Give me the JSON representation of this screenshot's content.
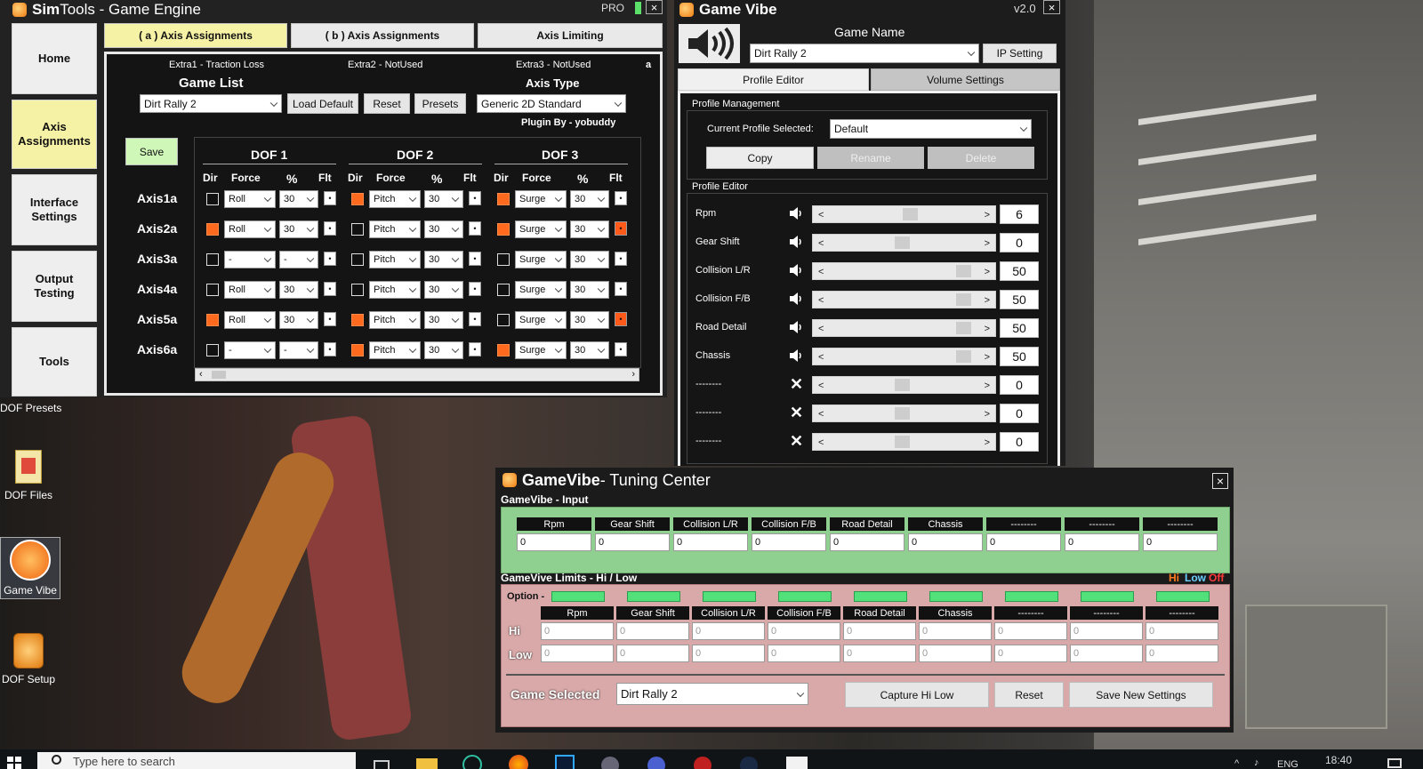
{
  "simtools": {
    "title_sim": "Sim",
    "title_rest": "Tools - Game Engine",
    "pro": "PRO",
    "close": "×",
    "sidebar": [
      "Home",
      "Axis\nAssignments",
      "Interface\nSettings",
      "Output\nTesting",
      "Tools"
    ],
    "tabs": [
      "( a ) Axis Assignments",
      "( b ) Axis Assignments",
      "Axis Limiting"
    ],
    "extras": [
      "Extra1 - Traction Loss",
      "Extra2 - NotUsed",
      "Extra3 - NotUsed"
    ],
    "extra_a": "a",
    "game_list_label": "Game List",
    "game_selected": "Dirt Rally 2",
    "load_default": "Load Default",
    "reset": "Reset",
    "presets": "Presets",
    "axis_type_label": "Axis Type",
    "axis_type": "Generic 2D Standard",
    "plugin_by": "Plugin By - yobuddy",
    "save": "Save",
    "dofs": [
      "DOF 1",
      "DOF 2",
      "DOF 3"
    ],
    "col_headers": {
      "dir": "Dir",
      "force": "Force",
      "pct": "%",
      "flt": "Flt"
    },
    "rows": [
      {
        "axis": "Axis1a",
        "d": [
          {
            "dir": false,
            "force": "Roll",
            "pct": "30",
            "flt": false
          },
          {
            "dir": true,
            "force": "Pitch",
            "pct": "30",
            "flt": false
          },
          {
            "dir": true,
            "force": "Surge",
            "pct": "30",
            "flt": false
          }
        ]
      },
      {
        "axis": "Axis2a",
        "d": [
          {
            "dir": true,
            "force": "Roll",
            "pct": "30",
            "flt": false
          },
          {
            "dir": false,
            "force": "Pitch",
            "pct": "30",
            "flt": false
          },
          {
            "dir": true,
            "force": "Surge",
            "pct": "30",
            "flt": true
          }
        ]
      },
      {
        "axis": "Axis3a",
        "d": [
          {
            "dir": false,
            "force": "-",
            "pct": "-",
            "flt": false
          },
          {
            "dir": false,
            "force": "Pitch",
            "pct": "30",
            "flt": false
          },
          {
            "dir": false,
            "force": "Surge",
            "pct": "30",
            "flt": false
          }
        ]
      },
      {
        "axis": "Axis4a",
        "d": [
          {
            "dir": false,
            "force": "Roll",
            "pct": "30",
            "flt": false
          },
          {
            "dir": false,
            "force": "Pitch",
            "pct": "30",
            "flt": false
          },
          {
            "dir": false,
            "force": "Surge",
            "pct": "30",
            "flt": false
          }
        ]
      },
      {
        "axis": "Axis5a",
        "d": [
          {
            "dir": true,
            "force": "Roll",
            "pct": "30",
            "flt": false
          },
          {
            "dir": true,
            "force": "Pitch",
            "pct": "30",
            "flt": false
          },
          {
            "dir": false,
            "force": "Surge",
            "pct": "30",
            "flt": true
          }
        ]
      },
      {
        "axis": "Axis6a",
        "d": [
          {
            "dir": false,
            "force": "-",
            "pct": "-",
            "flt": false
          },
          {
            "dir": true,
            "force": "Pitch",
            "pct": "30",
            "flt": false
          },
          {
            "dir": true,
            "force": "Surge",
            "pct": "30",
            "flt": false
          }
        ]
      }
    ]
  },
  "gamevibe": {
    "title": "Game Vibe",
    "version": "v2.0",
    "close": "×",
    "game_name_label": "Game Name",
    "game_name": "Dirt Rally 2",
    "ip_setting": "IP Setting",
    "tabs": [
      "Profile Editor",
      "Volume Settings"
    ],
    "profile_mgmt_label": "Profile Management",
    "current_profile_label": "Current Profile Selected:",
    "current_profile": "Default",
    "copy": "Copy",
    "rename": "Rename",
    "delete": "Delete",
    "profile_editor_label": "Profile Editor",
    "effects": [
      {
        "label": "Rpm",
        "value": "6",
        "muted": false,
        "level": 0.5
      },
      {
        "label": "Gear Shift",
        "value": "0",
        "muted": false,
        "level": 0.45
      },
      {
        "label": "Collision L/R",
        "value": "50",
        "muted": false,
        "level": 0.85
      },
      {
        "label": "Collision F/B",
        "value": "50",
        "muted": false,
        "level": 0.85
      },
      {
        "label": "Road Detail",
        "value": "50",
        "muted": false,
        "level": 0.85
      },
      {
        "label": "Chassis",
        "value": "50",
        "muted": false,
        "level": 0.85
      },
      {
        "label": "--------",
        "value": "0",
        "muted": true,
        "level": 0.45
      },
      {
        "label": "--------",
        "value": "0",
        "muted": true,
        "level": 0.45
      },
      {
        "label": "--------",
        "value": "0",
        "muted": true,
        "level": 0.45
      }
    ]
  },
  "tuning": {
    "title_bold": "GameVibe",
    "title_rest": " - Tuning Center",
    "close": "×",
    "input_label": "GameVibe - Input",
    "columns": [
      "Rpm",
      "Gear Shift",
      "Collision L/R",
      "Collision F/B",
      "Road Detail",
      "Chassis",
      "--------",
      "--------",
      "--------"
    ],
    "input_values": [
      "0",
      "0",
      "0",
      "0",
      "0",
      "0",
      "0",
      "0",
      "0"
    ],
    "limits_label": "GameVive Limits - Hi / Low",
    "legend_hi": "Hi",
    "legend_low": "Low",
    "legend_off": "Off",
    "option_label": "Option -",
    "hi_label": "Hi",
    "low_label": "Low",
    "hi_values": [
      "0",
      "0",
      "0",
      "0",
      "0",
      "0",
      "0",
      "0",
      "0"
    ],
    "low_values": [
      "0",
      "0",
      "0",
      "0",
      "0",
      "0",
      "0",
      "0",
      "0"
    ],
    "game_selected_label": "Game Selected",
    "game_selected": "Dirt Rally 2",
    "capture": "Capture Hi Low",
    "reset": "Reset",
    "save_new": "Save New Settings"
  },
  "desktop": {
    "icons": [
      "DOF Presets",
      "DOF Files",
      "Game Vibe",
      "DOF Setup"
    ]
  },
  "taskbar": {
    "search_placeholder": "Type here to search",
    "lang": "ENG",
    "time": "18:40"
  },
  "colors": {
    "accent_orange": "#ff6a1f",
    "tab_yellow": "#f6f2a5",
    "green_panel": "#8fcf8f",
    "red_panel": "#d9a9a9"
  }
}
